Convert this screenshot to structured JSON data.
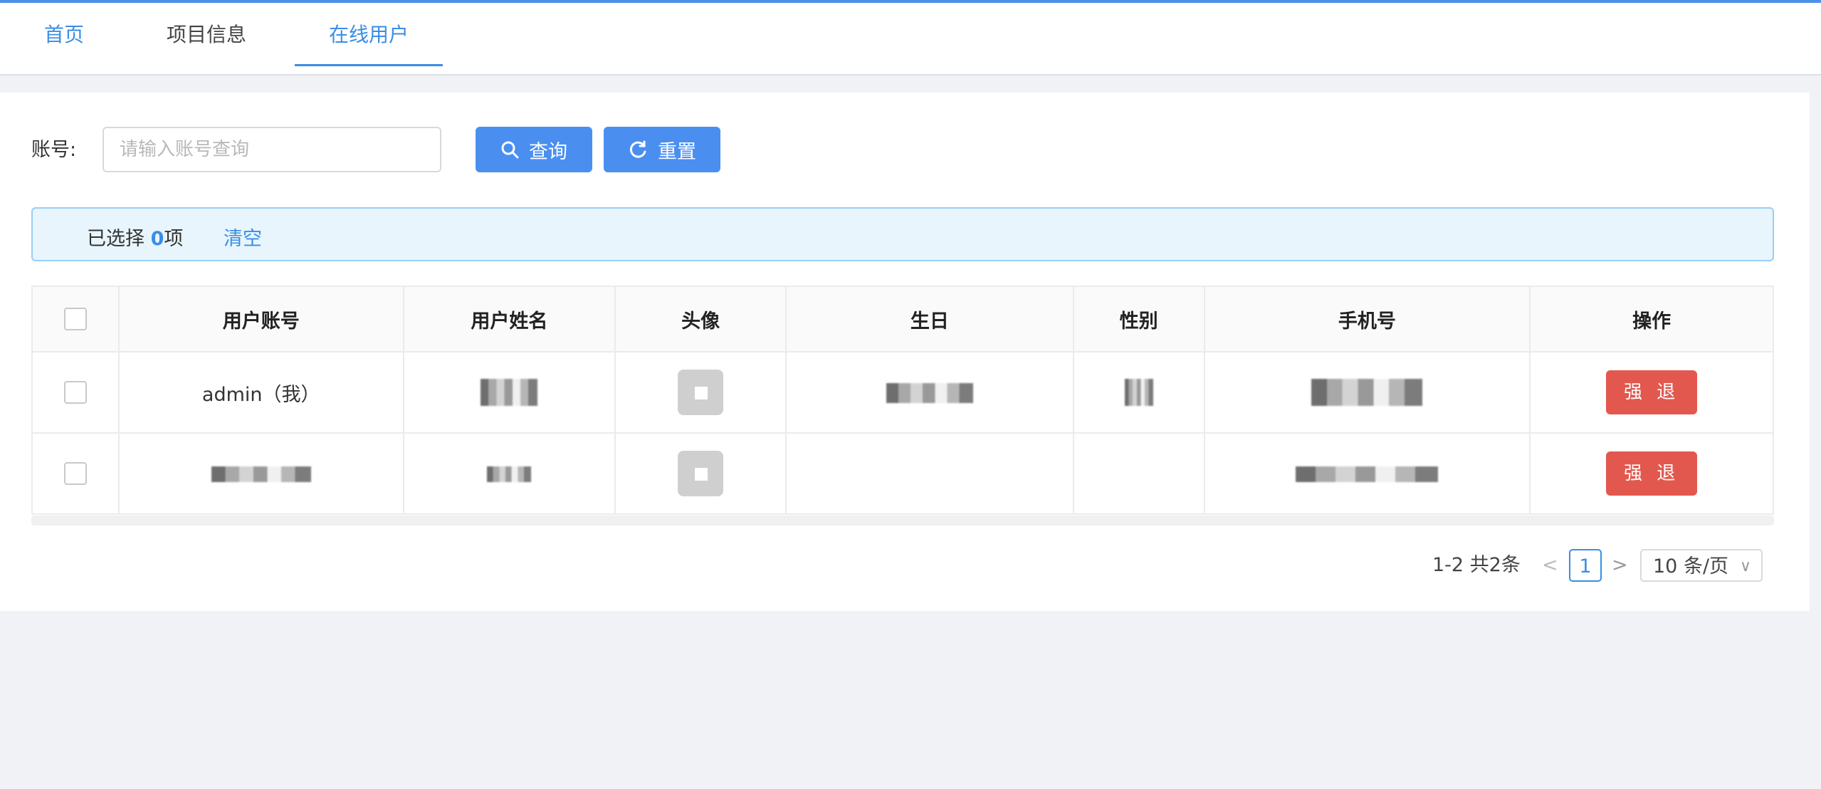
{
  "tabs": {
    "home": "首页",
    "project": "项目信息",
    "online": "在线用户"
  },
  "search": {
    "label": "账号:",
    "placeholder": "请输入账号查询",
    "value": ""
  },
  "buttons": {
    "query": "查询",
    "reset": "重置"
  },
  "selection": {
    "prefix": "已选择",
    "count": "0",
    "suffix": "项",
    "clear": "清空"
  },
  "table": {
    "headers": [
      "用户账号",
      "用户姓名",
      "头像",
      "生日",
      "性别",
      "手机号",
      "操作"
    ],
    "rows": [
      {
        "account": "admin（我）",
        "action": "强 退"
      },
      {
        "account": "",
        "action": "强 退"
      }
    ]
  },
  "pagination": {
    "total": "1-2 共2条",
    "current_page": "1",
    "page_size": "10 条/页"
  },
  "icons": [
    "search-icon",
    "refresh-icon",
    "chevron-left-icon",
    "chevron-right-icon",
    "chevron-down-icon"
  ],
  "colors": {
    "primary": "#4a8ff0",
    "danger": "#e3584e",
    "alert_bg": "#e8f5fd"
  }
}
